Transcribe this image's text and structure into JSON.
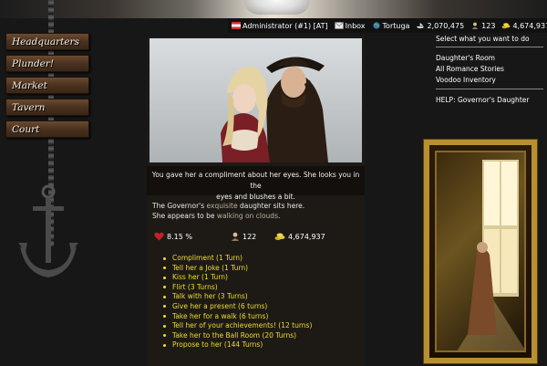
{
  "status": {
    "user": "Administrator (#1) [AT]",
    "inbox": "Inbox",
    "location": "Tortuga",
    "pirates": "2,070,475",
    "crew": "123",
    "gold": "4,674,937"
  },
  "nav": [
    "Headquarters",
    "Plunder!",
    "Market",
    "Tavern",
    "Court"
  ],
  "caption": {
    "line1": "You gave her a compliment about her eyes. She looks you in the",
    "line2": "eyes and blushes a bit."
  },
  "desc": {
    "pre1": "The Governor's ",
    "hl1": "exquisite",
    "post1": " daughter sits here.",
    "pre2": "She appears to be ",
    "hl2": "walking on clouds",
    "post2": "."
  },
  "stats": {
    "love": "8.15 %",
    "crew": "122",
    "gold": "4,674,937"
  },
  "actions": [
    "Compliment (1 Turn)",
    "Tell her a Joke (1 Turn)",
    "Kiss her (1 Turn)",
    "Flirt (3 Turns)",
    "Talk with her (3 Turns)",
    "Give her a present (6 turns)",
    "Take her for a walk (6 turns)",
    "Tell her of your achievements! (12 turns)",
    "Take her to the Ball Room (20 Turns)",
    "Propose to her (144 Turns)"
  ],
  "right": {
    "title": "Select what you want to do",
    "links": [
      "Daughter's Room",
      "All Romance Stories",
      "Voodoo Inventory"
    ],
    "help": "HELP: Governor's Daughter"
  },
  "colors": {
    "accent_link": "#f0dc2e",
    "highlight": "#b8b19d",
    "panel": "#1d1a16",
    "background": "#171717"
  }
}
